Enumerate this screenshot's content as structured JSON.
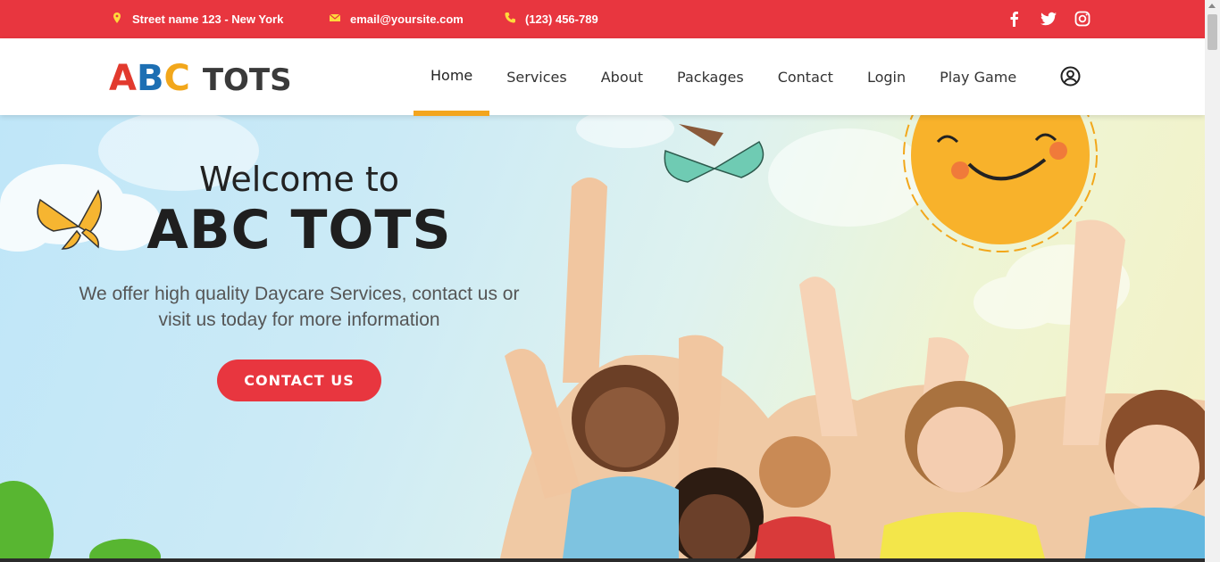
{
  "topbar": {
    "address": "Street name 123 - New York",
    "email": "email@yoursite.com",
    "phone": "(123) 456-789",
    "social_icons": [
      "facebook-icon",
      "twitter-icon",
      "instagram-icon"
    ]
  },
  "header": {
    "logo": {
      "letters": [
        "A",
        "B",
        "C"
      ],
      "word": "TOTS"
    },
    "nav": [
      {
        "label": "Home",
        "active": true
      },
      {
        "label": "Services"
      },
      {
        "label": "About"
      },
      {
        "label": "Packages"
      },
      {
        "label": "Contact"
      },
      {
        "label": "Login"
      },
      {
        "label": "Play Game"
      }
    ],
    "account_icon": "user-circle-icon"
  },
  "hero": {
    "welcome": "Welcome to",
    "brand": "ABC TOTS",
    "tagline_line1": "We offer high quality Daycare Services, contact us or",
    "tagline_line2": "visit us today for more information",
    "cta": "CONTACT US"
  },
  "colors": {
    "topbar": "#e8363f",
    "accent": "#f3a51e",
    "logo_a": "#e23a2e",
    "logo_b": "#1d6fb3",
    "logo_c": "#f2a71b"
  }
}
